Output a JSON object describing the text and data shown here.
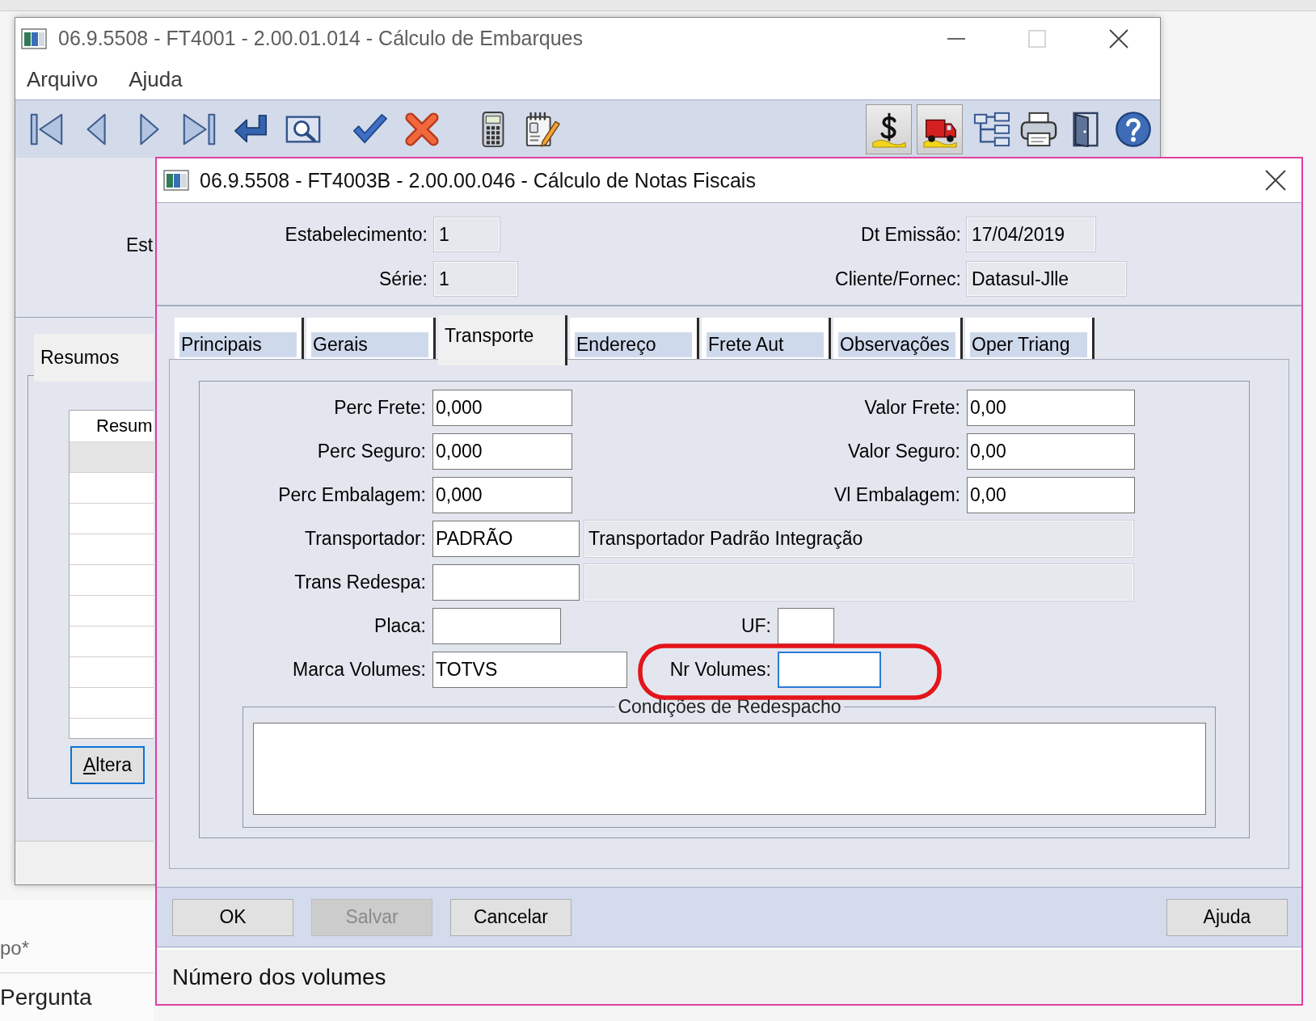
{
  "background_page": {
    "labels": [
      "po*",
      "Pergunta"
    ]
  },
  "background_window": {
    "title": "06.9.5508 - FT4001 - 2.00.01.014 - Cálculo de Embarques",
    "menu": [
      "Arquivo",
      "Ajuda"
    ],
    "toolbar_left": [
      {
        "kind": "first",
        "pressed": false
      },
      {
        "kind": "previous",
        "pressed": false
      },
      {
        "kind": "next",
        "pressed": false
      },
      {
        "kind": "last",
        "pressed": false
      },
      {
        "kind": "return",
        "pressed": false
      },
      {
        "kind": "zoom",
        "pressed": false
      },
      {
        "kind": "confirm",
        "pressed": false
      },
      {
        "kind": "cancel",
        "pressed": false
      },
      {
        "kind": "calculator",
        "pressed": false
      },
      {
        "kind": "notes",
        "pressed": false
      }
    ],
    "toolbar_right": [
      {
        "kind": "dollar",
        "pressed": true
      },
      {
        "kind": "truck",
        "pressed": true
      },
      {
        "kind": "tree",
        "pressed": false
      },
      {
        "kind": "print",
        "pressed": false
      },
      {
        "kind": "exit",
        "pressed": false
      },
      {
        "kind": "help",
        "pressed": false
      }
    ],
    "field_label": "Est",
    "tabs": [
      {
        "label": "Resumos",
        "selected": true
      }
    ],
    "table": {
      "columns": [
        "Resum"
      ],
      "rows": [
        {
          "selected": true
        },
        {
          "selected": false
        },
        {
          "selected": false
        },
        {
          "selected": false
        },
        {
          "selected": false
        },
        {
          "selected": false
        },
        {
          "selected": false
        },
        {
          "selected": false
        },
        {
          "selected": false
        },
        {
          "selected": false
        }
      ]
    },
    "buttons": [
      {
        "label": "Altera",
        "focused": true
      }
    ]
  },
  "dialog": {
    "title": "06.9.5508 - FT4003B - 2.00.00.046 - Cálculo de Notas Fiscais",
    "header_fields": [
      {
        "label": "Estabelecimento:",
        "value": "1"
      },
      {
        "label": "Dt Emissão:",
        "value": "17/04/2019"
      },
      {
        "label": "Série:",
        "value": "1"
      },
      {
        "label": "Cliente/Fornec:",
        "value": "Datasul-Jlle"
      }
    ],
    "tabs": [
      {
        "label": "Principais",
        "selected": false
      },
      {
        "label": "Gerais",
        "selected": false
      },
      {
        "label": "Transporte",
        "selected": true
      },
      {
        "label": "Endereço",
        "selected": false
      },
      {
        "label": "Frete Aut",
        "selected": false
      },
      {
        "label": "Observações",
        "selected": false
      },
      {
        "label": "Oper Triang",
        "selected": false
      }
    ],
    "rows": [
      {
        "kind": "pair",
        "fields": [
          {
            "kind": "percent",
            "label": "Perc Frete:",
            "value": "0,000",
            "focused": false,
            "circled": false
          },
          {
            "kind": "amount",
            "label": "Valor Frete:",
            "value": "0,00",
            "focused": false,
            "circled": false
          }
        ]
      },
      {
        "kind": "pair",
        "fields": [
          {
            "kind": "percent",
            "label": "Perc Seguro:",
            "value": "0,000",
            "focused": false,
            "circled": false
          },
          {
            "kind": "amount",
            "label": "Valor Seguro:",
            "value": "0,00",
            "focused": false,
            "circled": false
          }
        ]
      },
      {
        "kind": "pair",
        "fields": [
          {
            "kind": "percent",
            "label": "Perc Embalagem:",
            "value": "0,000",
            "focused": false,
            "circled": false
          },
          {
            "kind": "amount",
            "label": "Vl Embalagem:",
            "value": "0,00",
            "focused": false,
            "circled": false
          }
        ]
      },
      {
        "kind": "lookup",
        "fields": [
          {
            "kind": "code",
            "label": "Transportador:",
            "value": "PADRÃO",
            "focused": false,
            "circled": false
          }
        ],
        "description": "Transportador Padrão Integração"
      },
      {
        "kind": "lookup",
        "fields": [
          {
            "kind": "code",
            "label": "Trans Redespa:",
            "focused": false,
            "circled": false
          }
        ]
      },
      {
        "kind": "split",
        "fields": [
          {
            "kind": "plate",
            "label": "Placa:",
            "focused": false,
            "circled": false
          },
          {
            "kind": "state",
            "label": "UF:",
            "focused": false,
            "circled": false
          }
        ]
      },
      {
        "kind": "split",
        "fields": [
          {
            "kind": "text",
            "label": "Marca Volumes:",
            "value": "TOTVS",
            "focused": false,
            "circled": false
          },
          {
            "kind": "count",
            "label": "Nr Volumes:",
            "focused": true,
            "circled": true
          }
        ]
      }
    ],
    "conditions_group": {
      "title": "Condições de Redespacho"
    },
    "buttons": [
      {
        "label": "OK",
        "disabled": false
      },
      {
        "label": "Salvar",
        "disabled": true
      },
      {
        "label": "Cancelar",
        "disabled": false
      }
    ],
    "help_button": {
      "label": "Ajuda",
      "disabled": false
    },
    "status_bar": "Número dos volumes"
  }
}
